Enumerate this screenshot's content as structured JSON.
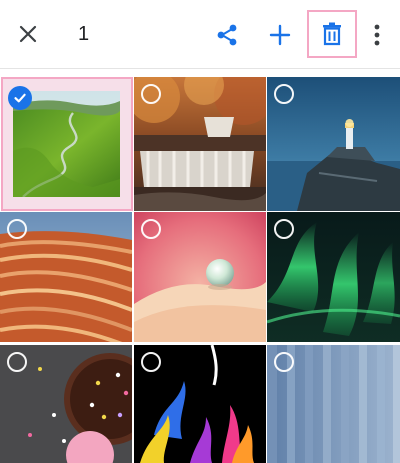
{
  "toolbar": {
    "close_icon": "close-icon",
    "selected_count": "1",
    "share_icon": "share-icon",
    "add_icon": "add-icon",
    "delete_icon": "trash-icon",
    "more_icon": "more-vert-icon",
    "accent_color": "#1a73e8",
    "highlight_color": "#f4a7c4"
  },
  "photos": [
    {
      "name": "green-valley-river",
      "selected": true
    },
    {
      "name": "autumn-waterfall",
      "selected": false
    },
    {
      "name": "lighthouse-cliff-dusk",
      "selected": false
    },
    {
      "name": "red-sandstone-waves",
      "selected": false
    },
    {
      "name": "water-droplet-petal",
      "selected": false
    },
    {
      "name": "aurora-borealis",
      "selected": false
    },
    {
      "name": "chocolate-donuts",
      "selected": false
    },
    {
      "name": "colorful-paint-splash",
      "selected": false
    },
    {
      "name": "blue-curtain",
      "selected": false
    }
  ]
}
